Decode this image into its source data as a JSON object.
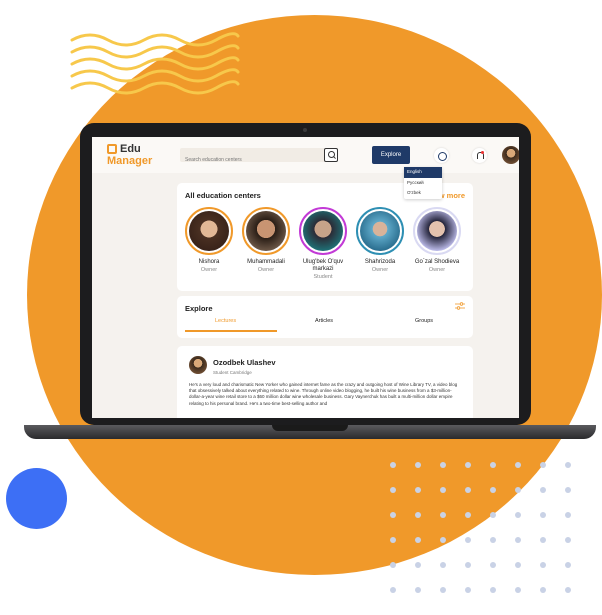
{
  "header": {
    "logo_line1": "Edu",
    "logo_line2": "Manager",
    "search_placeholder": "Search education centers",
    "explore_label": "Explore"
  },
  "language_menu": {
    "items": [
      "English",
      "Русский",
      "O'zbek"
    ],
    "selected": "English"
  },
  "centers": {
    "title": "All education centers",
    "view_more": "View more",
    "people": [
      {
        "name": "Nishora",
        "role": "Owner"
      },
      {
        "name": "Muhammadali",
        "role": "Owner"
      },
      {
        "name": "Ulug'bek O'quv markazi",
        "role": "Student"
      },
      {
        "name": "Shahrizoda",
        "role": "Owner"
      },
      {
        "name": "Go`zal Shodieva",
        "role": "Owner"
      }
    ]
  },
  "explore": {
    "title": "Explore",
    "tabs": [
      "Lectures",
      "Articles",
      "Groups"
    ],
    "active_tab": "Lectures"
  },
  "post": {
    "author": "Ozodbek Ulashev",
    "subtitle": "Student Cambridge",
    "body": "He's a very loud and charismatic New Yorker who gained internet fame as the crazy and outgoing host of Wine Library TV, a video blog that obsessively talked about everything related to wine. Through online video blogging, he built his wine business from a $3-million-dollar-a-year wine retail store to a $60 million dollar wine wholesale business. Gary Vaynerchuk has built a multi-million dollar empire relating to his personal brand. He's a two-time best-selling author and"
  },
  "colors": {
    "accent": "#F0992A",
    "primary": "#1F3A68",
    "blue_dot": "#3D6FF5"
  }
}
